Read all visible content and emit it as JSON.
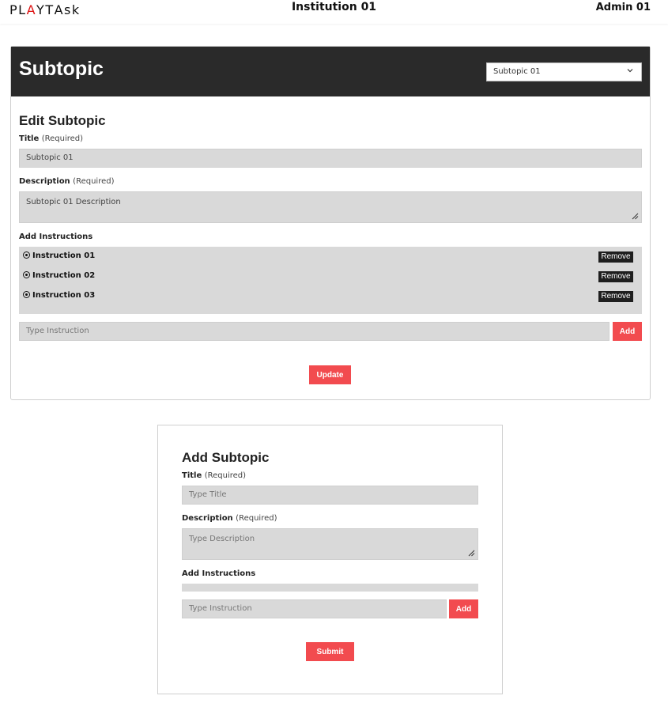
{
  "topbar": {
    "logo_letters": [
      "P",
      "L",
      "A",
      "Y",
      "T",
      "A",
      "s",
      "k"
    ],
    "institution": "Institution 01",
    "user": "Admin 01"
  },
  "edit": {
    "header_title": "Subtopic",
    "selector_value": "Subtopic 01",
    "heading": "Edit Subtopic",
    "title_label": "Title",
    "title_required": "(Required)",
    "title_value": "Subtopic 01",
    "description_label": "Description",
    "description_required": "(Required)",
    "description_value": "Subtopic 01 Description",
    "instructions_label": "Add Instructions",
    "instructions": [
      {
        "text": "Instruction 01",
        "remove_label": "Remove"
      },
      {
        "text": "Instruction 02",
        "remove_label": "Remove"
      },
      {
        "text": "Instruction 03",
        "remove_label": "Remove"
      }
    ],
    "instruction_placeholder": "Type Instruction",
    "add_label": "Add",
    "update_label": "Update"
  },
  "add": {
    "heading": "Add Subtopic",
    "title_label": "Title",
    "title_required": "(Required)",
    "title_placeholder": "Type Title",
    "description_label": "Description",
    "description_required": "(Required)",
    "description_placeholder": "Type Description",
    "instructions_label": "Add Instructions",
    "instruction_placeholder": "Type Instruction",
    "add_label": "Add",
    "submit_label": "Submit"
  },
  "colors": {
    "accent": "#f24b4f",
    "header_bg": "#2a2a2a",
    "field_bg": "#d9d9d9",
    "logo_accent": "#dd1111"
  }
}
